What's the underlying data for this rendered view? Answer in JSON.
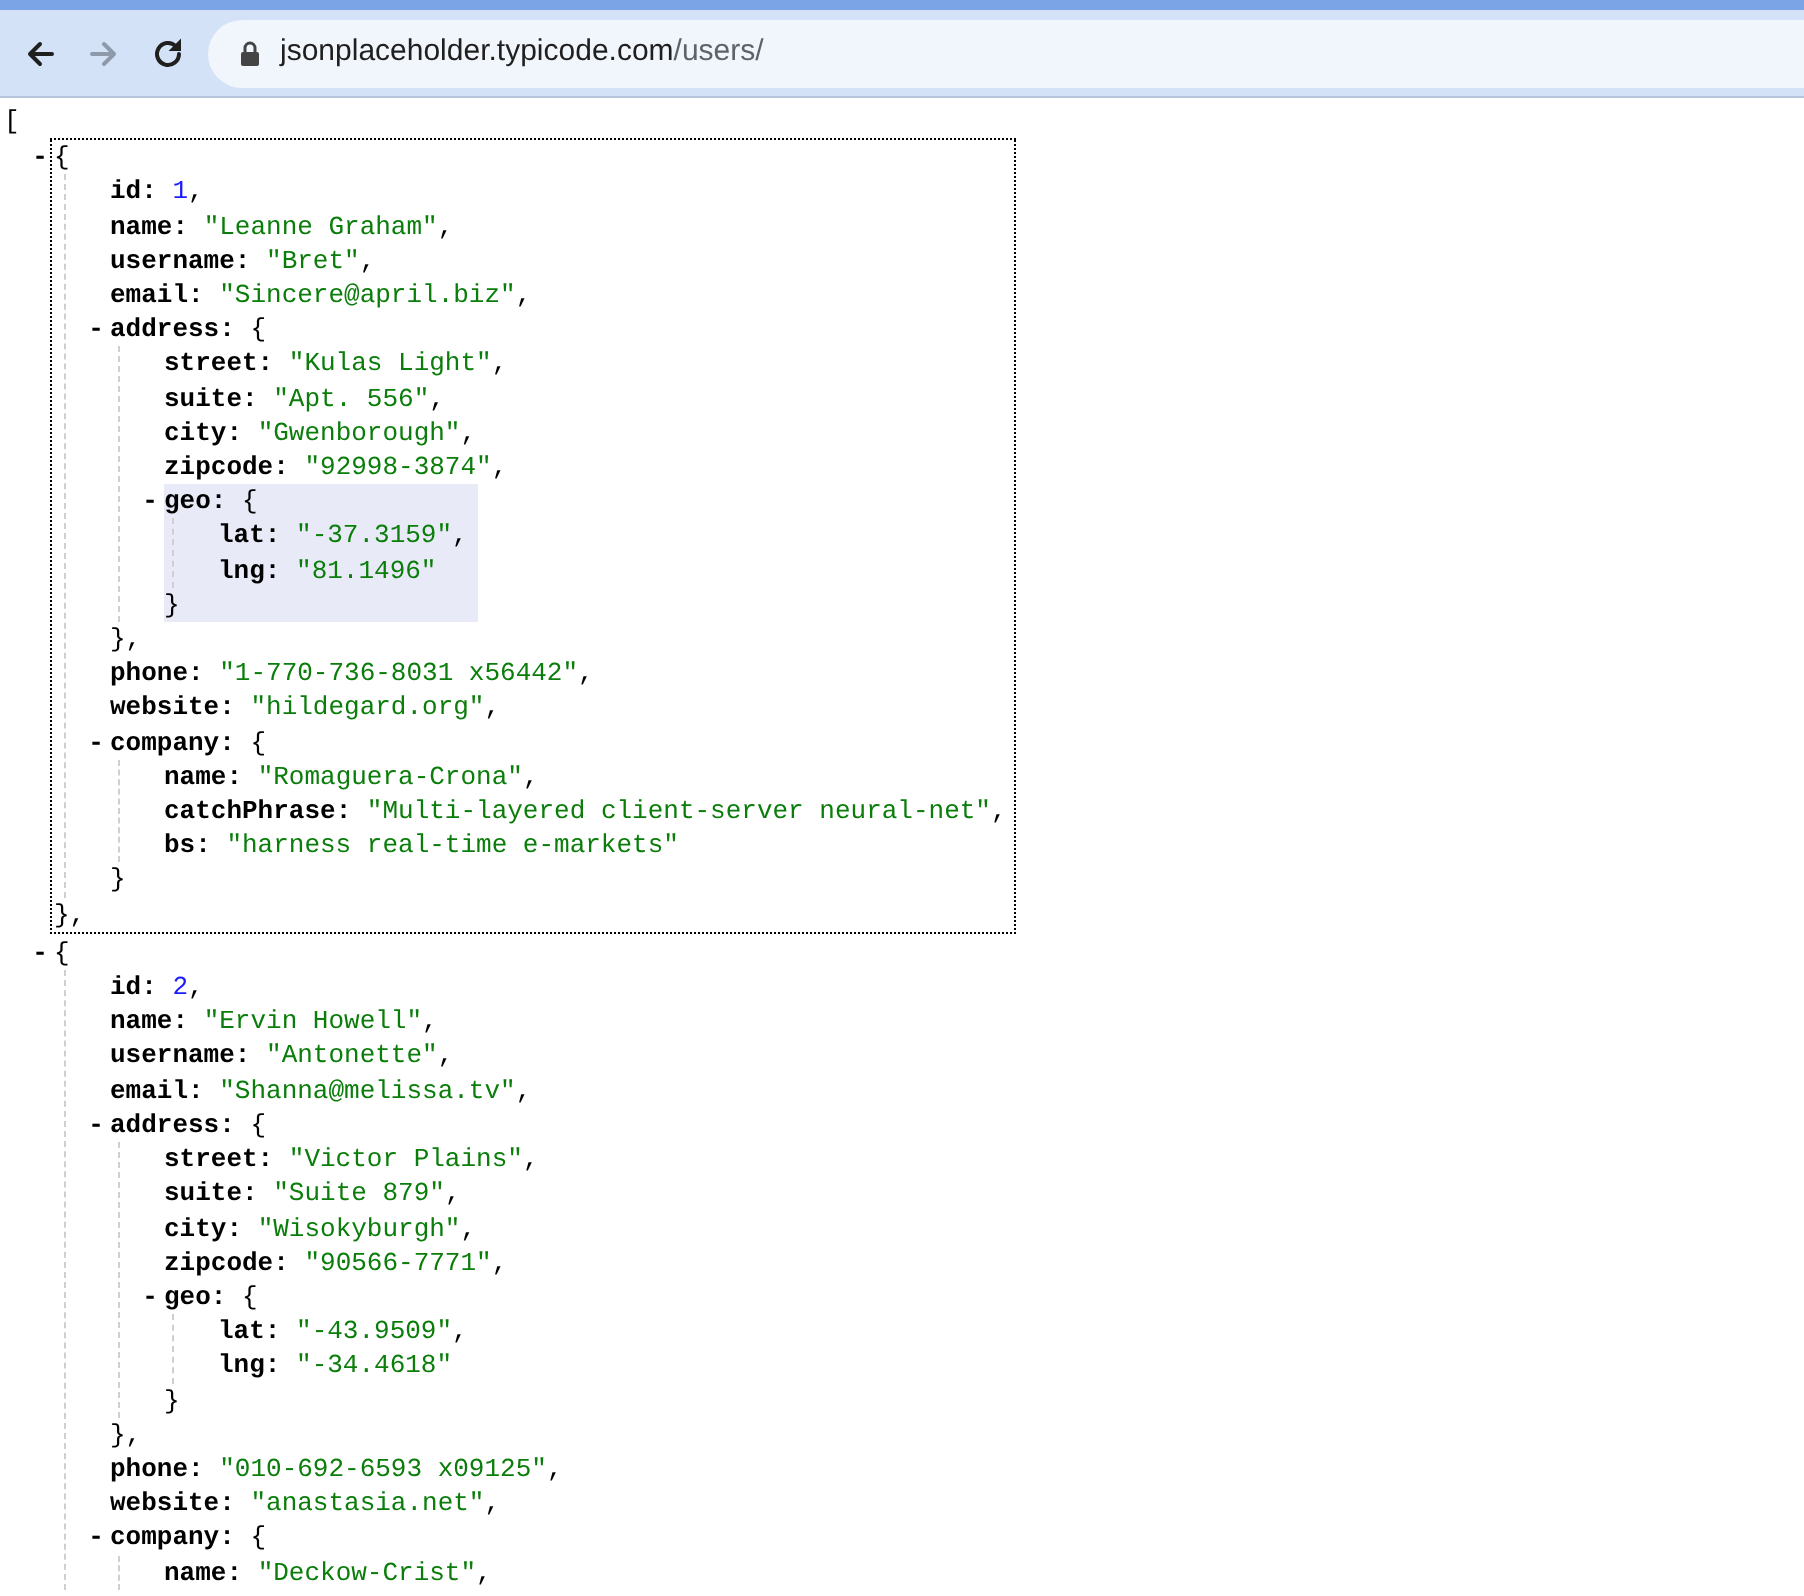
{
  "browser": {
    "nav_buttons": [
      {
        "kind": "back",
        "disabled": false
      },
      {
        "kind": "forward",
        "disabled": true
      },
      {
        "kind": "reload",
        "disabled": false
      }
    ],
    "url": {
      "host": "jsonplaceholder.typicode.com",
      "path": "/users/"
    }
  },
  "viewer": {
    "open": "[",
    "items": [
      {
        "kind": "object",
        "toggle": "-",
        "open": "{",
        "expanded": true,
        "focused": true,
        "close": "},",
        "children": [
          {
            "kind": "number",
            "key": "id:",
            "value": "1",
            "comma": ","
          },
          {
            "kind": "string",
            "key": "name:",
            "value": "\"Leanne Graham\"",
            "comma": ","
          },
          {
            "kind": "string",
            "key": "username:",
            "value": "\"Bret\"",
            "comma": ","
          },
          {
            "kind": "string",
            "key": "email:",
            "value": "\"Sincere@april.biz\"",
            "comma": ","
          },
          {
            "kind": "object",
            "toggle": "-",
            "key": "address:",
            "open": "{",
            "expanded": true,
            "close": "},",
            "children": [
              {
                "kind": "string",
                "key": "street:",
                "value": "\"Kulas Light\"",
                "comma": ","
              },
              {
                "kind": "string",
                "key": "suite:",
                "value": "\"Apt. 556\"",
                "comma": ","
              },
              {
                "kind": "string",
                "key": "city:",
                "value": "\"Gwenborough\"",
                "comma": ","
              },
              {
                "kind": "string",
                "key": "zipcode:",
                "value": "\"92998-3874\"",
                "comma": ","
              },
              {
                "kind": "object",
                "toggle": "-",
                "key": "geo:",
                "open": "{",
                "expanded": true,
                "highlighted": true,
                "close": "}",
                "children": [
                  {
                    "kind": "string",
                    "key": "lat:",
                    "value": "\"-37.3159\"",
                    "comma": ","
                  },
                  {
                    "kind": "string",
                    "key": "lng:",
                    "value": "\"81.1496\""
                  }
                ]
              }
            ]
          },
          {
            "kind": "string",
            "key": "phone:",
            "value": "\"1-770-736-8031 x56442\"",
            "comma": ","
          },
          {
            "kind": "string",
            "key": "website:",
            "value": "\"hildegard.org\"",
            "comma": ","
          },
          {
            "kind": "object",
            "toggle": "-",
            "key": "company:",
            "open": "{",
            "expanded": true,
            "close": "}",
            "children": [
              {
                "kind": "string",
                "key": "name:",
                "value": "\"Romaguera-Crona\"",
                "comma": ","
              },
              {
                "kind": "string",
                "key": "catchPhrase:",
                "value": "\"Multi-layered client-server neural-net\"",
                "comma": ","
              },
              {
                "kind": "string",
                "key": "bs:",
                "value": "\"harness real-time e-markets\""
              }
            ]
          }
        ]
      },
      {
        "kind": "object",
        "toggle": "-",
        "open": "{",
        "expanded": true,
        "children": [
          {
            "kind": "number",
            "key": "id:",
            "value": "2",
            "comma": ","
          },
          {
            "kind": "string",
            "key": "name:",
            "value": "\"Ervin Howell\"",
            "comma": ","
          },
          {
            "kind": "string",
            "key": "username:",
            "value": "\"Antonette\"",
            "comma": ","
          },
          {
            "kind": "string",
            "key": "email:",
            "value": "\"Shanna@melissa.tv\"",
            "comma": ","
          },
          {
            "kind": "object",
            "toggle": "-",
            "key": "address:",
            "open": "{",
            "expanded": true,
            "close": "},",
            "children": [
              {
                "kind": "string",
                "key": "street:",
                "value": "\"Victor Plains\"",
                "comma": ","
              },
              {
                "kind": "string",
                "key": "suite:",
                "value": "\"Suite 879\"",
                "comma": ","
              },
              {
                "kind": "string",
                "key": "city:",
                "value": "\"Wisokyburgh\"",
                "comma": ","
              },
              {
                "kind": "string",
                "key": "zipcode:",
                "value": "\"90566-7771\"",
                "comma": ","
              },
              {
                "kind": "object",
                "toggle": "-",
                "key": "geo:",
                "open": "{",
                "expanded": true,
                "close": "}",
                "children": [
                  {
                    "kind": "string",
                    "key": "lat:",
                    "value": "\"-43.9509\"",
                    "comma": ","
                  },
                  {
                    "kind": "string",
                    "key": "lng:",
                    "value": "\"-34.4618\""
                  }
                ]
              }
            ]
          },
          {
            "kind": "string",
            "key": "phone:",
            "value": "\"010-692-6593 x09125\"",
            "comma": ","
          },
          {
            "kind": "string",
            "key": "website:",
            "value": "\"anastasia.net\"",
            "comma": ","
          },
          {
            "kind": "object",
            "toggle": "-",
            "key": "company:",
            "open": "{",
            "expanded": true,
            "children": [
              {
                "kind": "string",
                "key": "name:",
                "value": "\"Deckow-Crist\"",
                "comma": ","
              }
            ]
          }
        ]
      }
    ]
  }
}
